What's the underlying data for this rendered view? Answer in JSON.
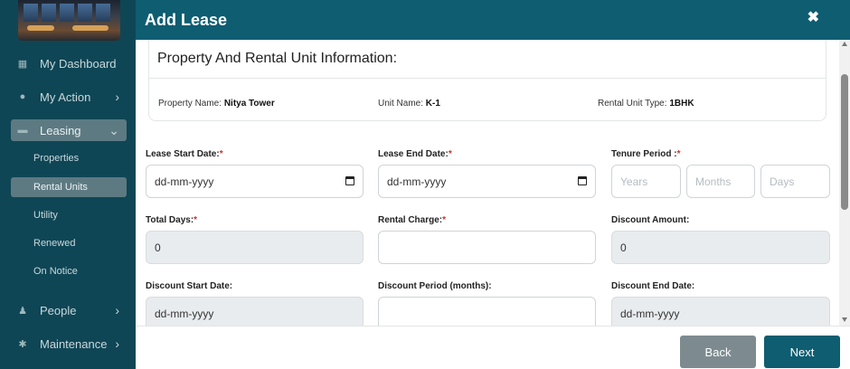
{
  "sidebar": {
    "items": [
      {
        "label": "My Dashboard",
        "icon": "dashboard-icon"
      },
      {
        "label": "My Action",
        "icon": "user-icon"
      },
      {
        "label": "Leasing",
        "icon": "folder-icon"
      },
      {
        "label": "People",
        "icon": "people-icon"
      },
      {
        "label": "Maintenance",
        "icon": "wrench-icon"
      }
    ],
    "leasing_sub": [
      "Properties",
      "Rental Units",
      "Utility",
      "Renewed",
      "On Notice"
    ]
  },
  "modal": {
    "title": "Add Lease",
    "close": "✖",
    "section_title": "Property And Rental Unit Information:",
    "property_name_label": "Property Name:",
    "property_name": "Nitya Tower",
    "unit_name_label": "Unit Name:",
    "unit_name": "K-1",
    "unit_type_label": "Rental Unit Type:",
    "unit_type": "1BHK"
  },
  "form": {
    "lease_start_label": "Lease Start Date:",
    "lease_start_value": "dd-mm-yyyy",
    "lease_end_label": "Lease End Date:",
    "lease_end_value": "dd-mm-yyyy",
    "tenure_label": "Tenure Period :",
    "tenure_years_ph": "Years",
    "tenure_months_ph": "Months",
    "tenure_days_ph": "Days",
    "total_days_label": "Total Days:",
    "total_days_value": "0",
    "rental_charge_label": "Rental Charge:",
    "rental_charge_value": "",
    "discount_amount_label": "Discount Amount:",
    "discount_amount_value": "0",
    "discount_start_label": "Discount Start Date:",
    "discount_start_value": "dd-mm-yyyy",
    "discount_period_label": "Discount Period (months):",
    "discount_period_value": "",
    "discount_end_label": "Discount End Date:",
    "discount_end_value": "dd-mm-yyyy",
    "required_mark": "*"
  },
  "footer": {
    "back_label": "Back",
    "next_label": "Next"
  },
  "colors": {
    "sidebar": "#0f4655",
    "header": "#0e5d71",
    "back_button": "#7d8b91",
    "next_button": "#0e5d71",
    "required": "#d32f2f"
  }
}
